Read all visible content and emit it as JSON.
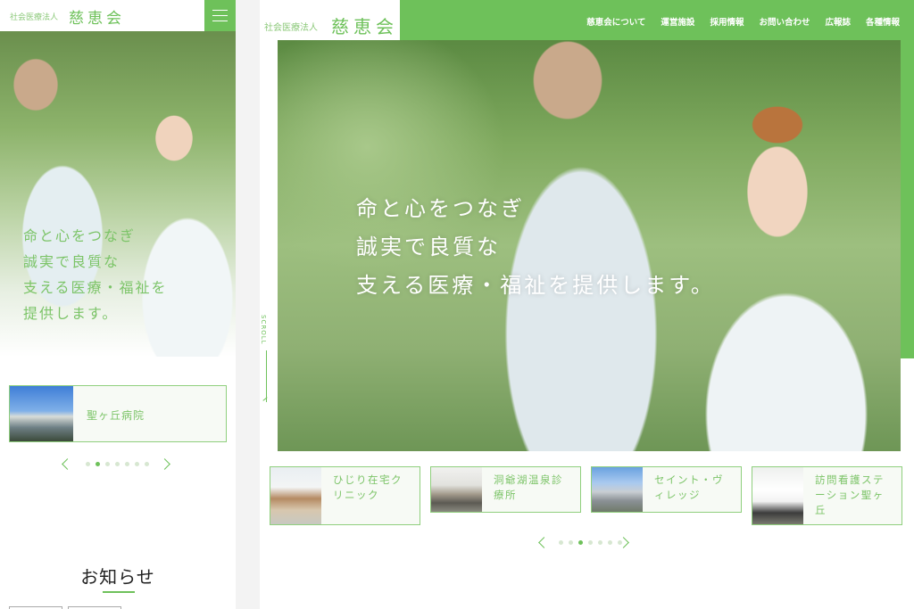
{
  "mobile": {
    "header": {
      "corp_type": "社会医療法人",
      "org_name": "慈恵会",
      "menu_icon": "hamburger-icon"
    },
    "hero": {
      "copy_lines": [
        "命と心をつなぎ",
        "誠実で良質な",
        "支える医療・福祉を",
        "提供します。"
      ]
    },
    "facility_card": {
      "label": "聖ヶ丘病院",
      "image": "hospital-building-photo"
    },
    "slider": {
      "dot_count": 7,
      "active_index": 1,
      "prev_icon": "chevron-left-icon",
      "next_icon": "chevron-right-icon"
    },
    "news": {
      "heading": "お知らせ"
    }
  },
  "desktop": {
    "header": {
      "corp_type": "社会医療法人",
      "org_name": "慈恵会",
      "nav": [
        "慈恵会について",
        "運営施設",
        "採用情報",
        "お問い合わせ",
        "広報誌",
        "各種情報"
      ]
    },
    "hero": {
      "copy_lines": [
        "命と心をつなぎ",
        "誠実で良質な",
        "支える医療・福祉を提供します。"
      ],
      "scroll_label": "SCROLL"
    },
    "facility_cards": [
      {
        "label": "ひじり在宅クリニック",
        "image": "clinic-building-photo"
      },
      {
        "label": "洞爺湖温泉診療所",
        "image": "clinic-entrance-photo"
      },
      {
        "label": "セイント・ヴィレッジ",
        "image": "residence-building-photo"
      },
      {
        "label": "訪問看護ステーション聖ヶ丘",
        "image": "nursing-van-photo"
      }
    ],
    "slider": {
      "dot_count": 7,
      "active_index": 2,
      "prev_icon": "chevron-left-icon",
      "next_icon": "chevron-right-icon"
    }
  },
  "colors": {
    "accent": "#6ec15a",
    "accent_text": "#7cc468",
    "card_border": "#8fcf7d"
  }
}
